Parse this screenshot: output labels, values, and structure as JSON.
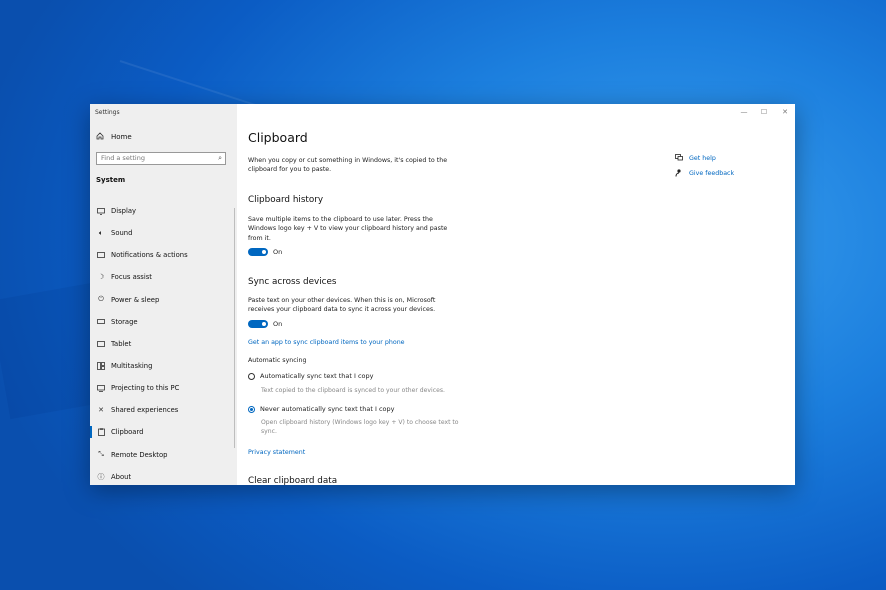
{
  "window": {
    "title": "Settings",
    "controls": {
      "minimize": "—",
      "maximize": "☐",
      "close": "✕"
    }
  },
  "sidebar": {
    "home_label": "Home",
    "search_placeholder": "Find a setting",
    "section_title": "System",
    "items": [
      {
        "label": "Display",
        "icon": "display-icon"
      },
      {
        "label": "Sound",
        "icon": "sound-icon"
      },
      {
        "label": "Notifications & actions",
        "icon": "notifications-icon"
      },
      {
        "label": "Focus assist",
        "icon": "focus-assist-icon"
      },
      {
        "label": "Power & sleep",
        "icon": "power-icon"
      },
      {
        "label": "Storage",
        "icon": "storage-icon"
      },
      {
        "label": "Tablet",
        "icon": "tablet-icon"
      },
      {
        "label": "Multitasking",
        "icon": "multitasking-icon"
      },
      {
        "label": "Projecting to this PC",
        "icon": "projecting-icon"
      },
      {
        "label": "Shared experiences",
        "icon": "shared-experiences-icon"
      },
      {
        "label": "Clipboard",
        "icon": "clipboard-icon",
        "active": true
      },
      {
        "label": "Remote Desktop",
        "icon": "remote-desktop-icon"
      },
      {
        "label": "About",
        "icon": "about-icon"
      }
    ]
  },
  "main": {
    "title": "Clipboard",
    "intro": "When you copy or cut something in Windows, it's copied to the clipboard for you to paste.",
    "history": {
      "heading": "Clipboard history",
      "description": "Save multiple items to the clipboard to use later. Press the Windows logo key + V to view your clipboard history and paste from it.",
      "toggle_label": "On"
    },
    "sync": {
      "heading": "Sync across devices",
      "description": "Paste text on your other devices. When this is on, Microsoft receives your clipboard data to sync it across your devices.",
      "toggle_label": "On",
      "app_link": "Get an app to sync clipboard items to your phone",
      "auto_heading": "Automatic syncing",
      "option_auto": "Automatically sync text that I copy",
      "option_auto_desc": "Text copied to the clipboard is synced to your other devices.",
      "option_never": "Never automatically sync text that I copy",
      "option_never_desc": "Open clipboard history (Windows logo key + V) to choose text to sync."
    },
    "privacy_link": "Privacy statement",
    "clear_heading": "Clear clipboard data"
  },
  "help": {
    "get_help": "Get help",
    "give_feedback": "Give feedback"
  },
  "colors": {
    "accent": "#0067c0",
    "desktop": "#1c7fde",
    "sidebar_bg": "#efefef"
  }
}
